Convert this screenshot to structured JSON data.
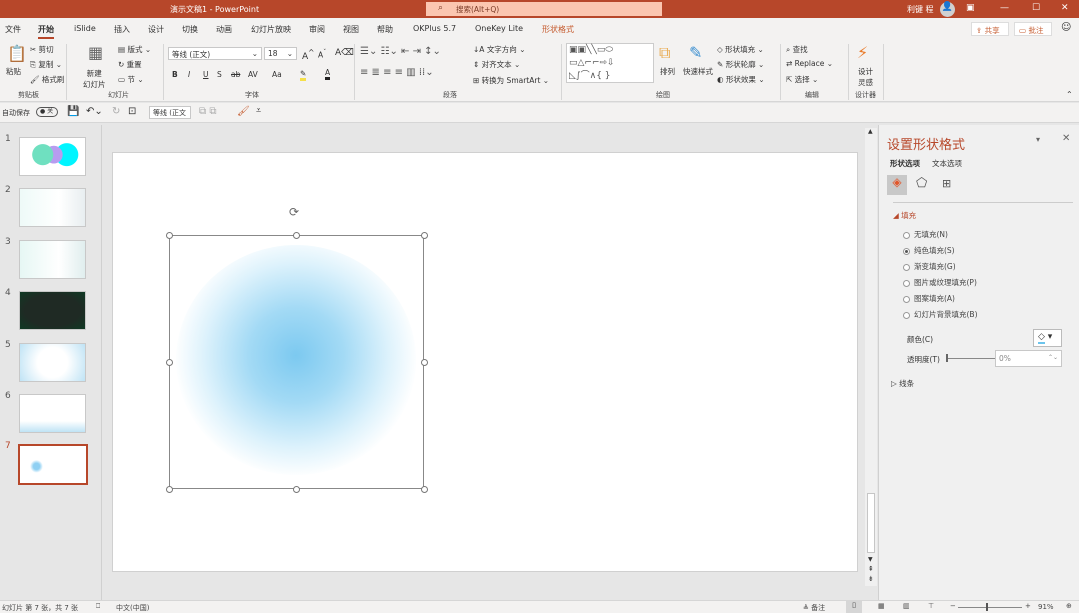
{
  "window": {
    "title": "演示文稿1  -  PowerPoint",
    "search_placeholder": "搜索(Alt+Q)",
    "user": "利键 程",
    "brand_color": "#b7472a"
  },
  "tabs": [
    "文件",
    "开始",
    "iSlide",
    "插入",
    "设计",
    "切换",
    "动画",
    "幻灯片放映",
    "审阅",
    "视图",
    "帮助",
    "OKPlus 5.7",
    "OneKey Lite",
    "形状格式"
  ],
  "active_tab": "开始",
  "share": "共享",
  "comments": "批注",
  "ribbon": {
    "clipboard": {
      "paste": "粘贴",
      "cut": "剪切",
      "copy": "复制",
      "format_painter": "格式刷",
      "label": "剪贴板"
    },
    "slides": {
      "new_slide": "新建\n幻灯片",
      "layout": "版式",
      "reset": "重置",
      "section": "节",
      "label": "幻灯片"
    },
    "font": {
      "name": "等线 (正文)",
      "size": "18",
      "label": "字体",
      "bold": "B",
      "italic": "I",
      "underline": "U",
      "shadow": "S",
      "strike": "ab",
      "spacing": "AV",
      "case": "Aa"
    },
    "paragraph": {
      "text_direction": "文字方向",
      "align_text": "对齐文本",
      "smartart": "转换为 SmartArt",
      "label": "段落"
    },
    "drawing": {
      "arrange": "排列",
      "quick_styles": "快速样式",
      "shape_fill": "形状填充",
      "shape_outline": "形状轮廓",
      "shape_effects": "形状效果",
      "label": "绘图"
    },
    "editing": {
      "find": "查找",
      "replace": "Replace",
      "select": "选择",
      "label": "编辑"
    },
    "designer": {
      "design_ideas": "设计\n灵感",
      "label": "设计器"
    }
  },
  "qat": {
    "autosave": "自动保存",
    "autosave_state": "关",
    "font": "等线 (正文"
  },
  "slides": {
    "count": 7,
    "selected": 7,
    "numbers": [
      "1",
      "2",
      "3",
      "4",
      "5",
      "6",
      "7"
    ]
  },
  "pane": {
    "title": "设置形状格式",
    "tabs": [
      "形状选项",
      "文本选项"
    ],
    "fill_section": "填充",
    "options": [
      "无填充(N)",
      "纯色填充(S)",
      "渐变填充(G)",
      "图片或纹理填充(P)",
      "图案填充(A)",
      "幻灯片背景填充(B)"
    ],
    "selected_option": 1,
    "color_label": "颜色(C)",
    "transparency_label": "透明度(T)",
    "transparency_value": "0%",
    "line_section": "线条"
  },
  "shape": {
    "glow_color": "#7cc9f0"
  },
  "status": {
    "slide_info": "幻灯片 第 7 张，共 7 张",
    "language": "中文(中国)",
    "notes": "备注",
    "zoom": "91%"
  }
}
